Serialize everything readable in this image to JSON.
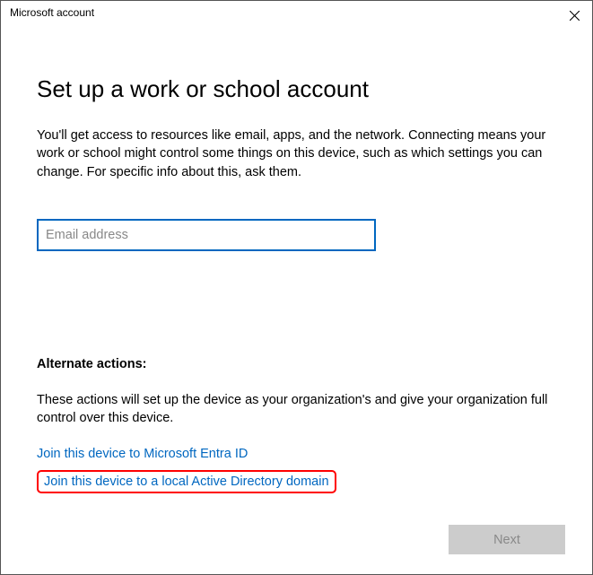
{
  "titlebar": {
    "title": "Microsoft account"
  },
  "main": {
    "heading": "Set up a work or school account",
    "description": "You'll get access to resources like email, apps, and the network. Connecting means your work or school might control some things on this device, such as which settings you can change. For specific info about this, ask them.",
    "email_placeholder": "Email address",
    "email_value": ""
  },
  "alternate": {
    "heading": "Alternate actions:",
    "description": "These actions will set up the device as your organization's and give your organization full control over this device.",
    "link_entra": "Join this device to Microsoft Entra ID",
    "link_ad": "Join this device to a local Active Directory domain"
  },
  "footer": {
    "next_label": "Next"
  }
}
